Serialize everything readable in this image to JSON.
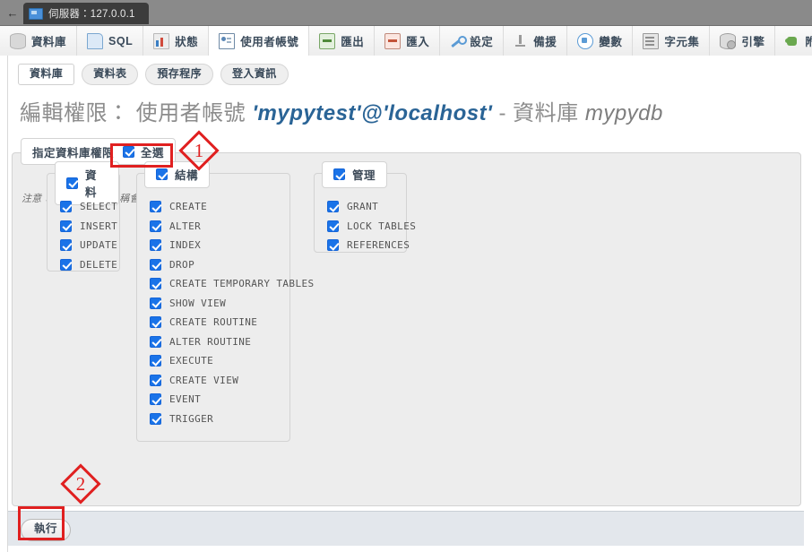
{
  "browser": {
    "back_label": "←",
    "tab_title": "伺服器：127.0.0.1",
    "tab_icon": "server-icon"
  },
  "main_nav": {
    "items": [
      {
        "label": "資料庫",
        "icon": "database-icon",
        "active": false
      },
      {
        "label": "SQL",
        "icon": "sql-document-icon",
        "active": false
      },
      {
        "label": "狀態",
        "icon": "status-chart-icon",
        "active": false
      },
      {
        "label": "使用者帳號",
        "icon": "user-account-icon",
        "active": true
      },
      {
        "label": "匯出",
        "icon": "export-icon",
        "active": false
      },
      {
        "label": "匯入",
        "icon": "import-icon",
        "active": false
      },
      {
        "label": "設定",
        "icon": "settings-wrench-icon",
        "active": false
      },
      {
        "label": "備援",
        "icon": "replication-icon",
        "active": false
      },
      {
        "label": "變數",
        "icon": "variables-icon",
        "active": false
      },
      {
        "label": "字元集",
        "icon": "charset-icon",
        "active": false
      },
      {
        "label": "引擎",
        "icon": "engine-icon",
        "active": false
      },
      {
        "label": "附加元件",
        "icon": "plugin-icon",
        "active": false
      }
    ]
  },
  "sub_tabs": {
    "items": [
      {
        "label": "資料庫",
        "active": true
      },
      {
        "label": "資料表",
        "active": false
      },
      {
        "label": "預存程序",
        "active": false
      },
      {
        "label": "登入資訊",
        "active": false
      }
    ]
  },
  "page_title": {
    "prefix": "編輯權限：",
    "user_label": "使用者帳號",
    "user_value": "'mypytest'@'localhost'",
    "separator": "-",
    "db_label": "資料庫",
    "db_value": "mypydb"
  },
  "fieldset": {
    "legend_text": "指定資料庫權限",
    "check_all_label": "全選",
    "check_all_checked": true,
    "note": "注意：MySQL 權限名稱會以英文表示。"
  },
  "groups": [
    {
      "name": "data",
      "title": "資料",
      "checked": true,
      "privileges": [
        {
          "label": "SELECT",
          "checked": true
        },
        {
          "label": "INSERT",
          "checked": true
        },
        {
          "label": "UPDATE",
          "checked": true
        },
        {
          "label": "DELETE",
          "checked": true
        }
      ]
    },
    {
      "name": "structure",
      "title": "結構",
      "checked": true,
      "privileges": [
        {
          "label": "CREATE",
          "checked": true
        },
        {
          "label": "ALTER",
          "checked": true
        },
        {
          "label": "INDEX",
          "checked": true
        },
        {
          "label": "DROP",
          "checked": true
        },
        {
          "label": "CREATE TEMPORARY TABLES",
          "checked": true
        },
        {
          "label": "SHOW VIEW",
          "checked": true
        },
        {
          "label": "CREATE ROUTINE",
          "checked": true
        },
        {
          "label": "ALTER ROUTINE",
          "checked": true
        },
        {
          "label": "EXECUTE",
          "checked": true
        },
        {
          "label": "CREATE VIEW",
          "checked": true
        },
        {
          "label": "EVENT",
          "checked": true
        },
        {
          "label": "TRIGGER",
          "checked": true
        }
      ]
    },
    {
      "name": "administration",
      "title": "管理",
      "checked": true,
      "privileges": [
        {
          "label": "GRANT",
          "checked": true
        },
        {
          "label": "LOCK TABLES",
          "checked": true
        },
        {
          "label": "REFERENCES",
          "checked": true
        }
      ]
    }
  ],
  "action_bar": {
    "go_label": "執行"
  },
  "annotations": [
    {
      "number": "1",
      "target": "check-all-checkbox"
    },
    {
      "number": "2",
      "target": "go-button"
    }
  ],
  "colors": {
    "checkbox_blue": "#1a73e8",
    "annotation_red": "#e02020",
    "title_gray": "#8c8c8c",
    "accent_blue": "#2a6496"
  }
}
